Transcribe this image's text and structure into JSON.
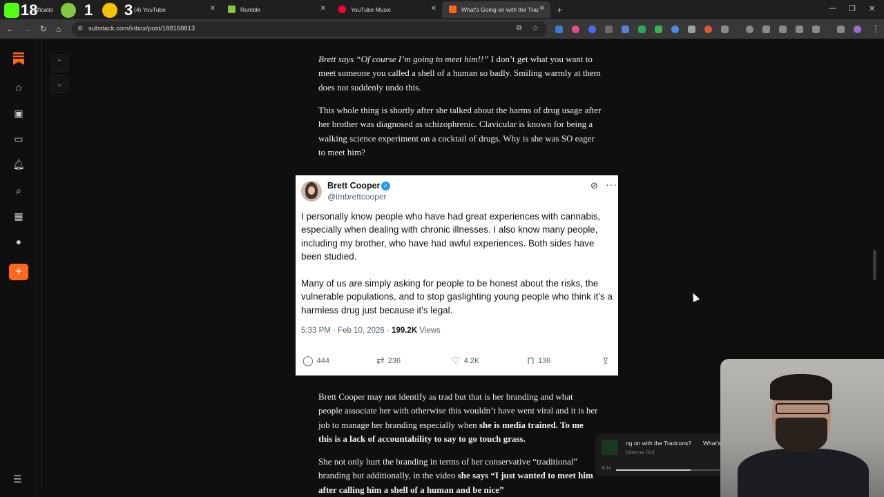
{
  "browser": {
    "tabs": [
      {
        "label": "otificatio",
        "color": "#53fc18"
      },
      {
        "label": "(4) YouTube",
        "color": "#ff0000"
      },
      {
        "label": "Rumble",
        "color": "#85c742"
      },
      {
        "label": "YouTube Music",
        "color": "#ff0033"
      },
      {
        "label": "What's Going on with the Trad",
        "color": "#ff6719"
      }
    ],
    "overlay_counts": [
      "18",
      "1",
      "3"
    ],
    "url": "substack.com/inbox/post/188168813",
    "window_controls": [
      "—",
      "❐",
      "✕"
    ]
  },
  "article": {
    "para1_italic": "Brett says “Of course I’m going to meet him!!”",
    "para1_rest": " I don’t get what you want to meet someone you called a shell of a human so badly. Smiling warmly at them does not suddenly undo this.",
    "para2": "This whole thing is shortly after she talked about the harms of drug usage after her brother was diagnosed as schizophrenic. Clavicular is known for being a walking science experiment on a cocktail of drugs. Why is she was SO eager to meet him?",
    "para3_plain": "Brett Cooper may not identify as trad but that is her branding and what people associate her with otherwise this wouldn’t have went viral and it is her job to manage her branding especially when ",
    "para3_bold": "she is media trained. To me this is a lack of accountability to say to go touch grass.",
    "para4_a": "She not only hurt the branding in terms of her conservative “traditional” branding but additionally, in the video ",
    "para4_bold1": "she says “I just wanted to meet him after calling him a shell of a human and be nice”",
    "para4_rest": ""
  },
  "tweet": {
    "name": "Brett Cooper",
    "handle": "@imbrettcooper",
    "paragraph1": "I personally know people who have had great experiences with cannabis, especially when dealing with chronic illnesses. I also know many people, including my brother, who have had awful experiences. Both sides have been studied.",
    "paragraph2": "Many of us are simply asking for people to be honest about the risks, the vulnerable populations, and to stop gaslighting young people who think it’s a harmless drug just because it’s legal.",
    "time": "5:33 PM · Feb 10, 2026 · ",
    "views_count": "199.2K",
    "views_label": " Views",
    "replies": "444",
    "reposts": "236",
    "likes": "4.2K",
    "bookmarks": "136"
  },
  "miniplayer": {
    "title": "ng on with the Tradcons?",
    "next": "What's",
    "artist": "Internet Girl",
    "time": "4:24",
    "progress": 0.72
  },
  "colors": {
    "accent": "#ff6719",
    "verified": "#1d9bf0"
  }
}
